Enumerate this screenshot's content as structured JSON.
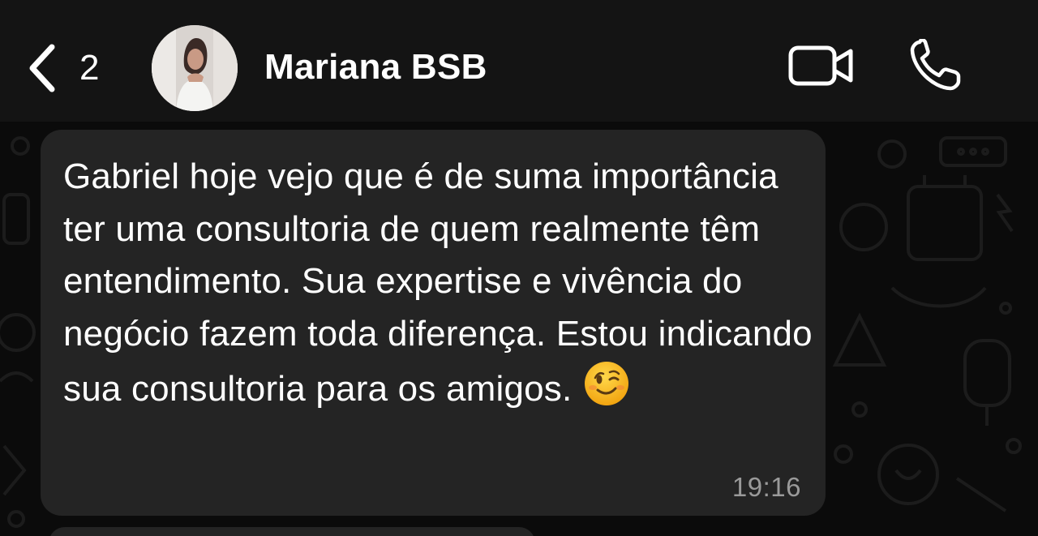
{
  "header": {
    "back_label": "2",
    "contact_name": "Mariana BSB"
  },
  "message": {
    "text": "Gabriel hoje vejo que é de suma importância ter uma consultoria de quem realmente têm entendimento. Sua expertise e vivência do negócio fazem toda diferença. Estou indicando sua consultoria para os amigos.",
    "emoji": "winking-face",
    "time": "19:16"
  },
  "colors": {
    "header_bg": "#141414",
    "chat_bg": "#0b0b0b",
    "bubble_bg": "#242424",
    "timestamp": "#9a9a9a"
  },
  "icons": [
    "chevron-left-icon",
    "video-camera-icon",
    "phone-icon"
  ]
}
